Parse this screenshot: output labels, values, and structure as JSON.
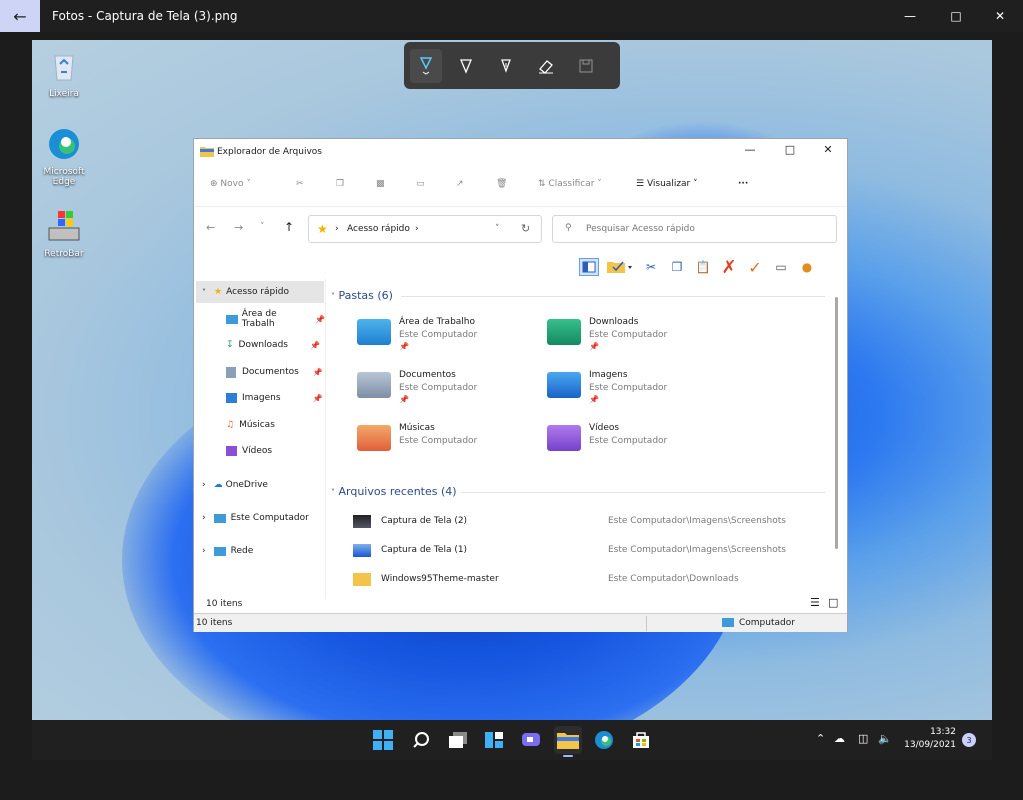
{
  "photos": {
    "title": "Fotos - Captura de Tela (3).png"
  },
  "desktop": {
    "icons": [
      {
        "label": "Lixeira"
      },
      {
        "label": "Microsoft Edge"
      },
      {
        "label": "RetroBar"
      }
    ]
  },
  "explorer": {
    "title": "Explorador de Arquivos",
    "cmd": {
      "new": "Novo",
      "sort": "Classificar",
      "view": "Visualizar",
      "more": "···"
    },
    "address": {
      "label": "Acesso rápido"
    },
    "search": {
      "placeholder": "Pesquisar Acesso rápido"
    },
    "nav": {
      "quick_access": "Acesso rápido",
      "items": [
        "Área de Trabalh",
        "Downloads",
        "Documentos",
        "Imagens",
        "Músicas",
        "Vídeos"
      ],
      "onedrive": "OneDrive",
      "this_pc": "Este Computador",
      "network": "Rede"
    },
    "folders_header": "Pastas (6)",
    "folders": [
      {
        "name": "Área de Trabalho",
        "sub": "Este Computador"
      },
      {
        "name": "Downloads",
        "sub": "Este Computador"
      },
      {
        "name": "Documentos",
        "sub": "Este Computador"
      },
      {
        "name": "Imagens",
        "sub": "Este Computador"
      },
      {
        "name": "Músicas",
        "sub": "Este Computador"
      },
      {
        "name": "Vídeos",
        "sub": "Este Computador"
      }
    ],
    "recent_header": "Arquivos recentes (4)",
    "recent": [
      {
        "name": "Captura de Tela (2)",
        "path": "Este Computador\\Imagens\\Screenshots"
      },
      {
        "name": "Captura de Tela (1)",
        "path": "Este Computador\\Imagens\\Screenshots"
      },
      {
        "name": "Windows95Theme-master",
        "path": "Este Computador\\Downloads"
      }
    ],
    "status_items": "10 itens",
    "statusbar_items": "10 itens",
    "statusbar_location": "Computador"
  },
  "taskbar": {
    "time": "13:32",
    "date": "13/09/2021",
    "notifications": "3"
  }
}
